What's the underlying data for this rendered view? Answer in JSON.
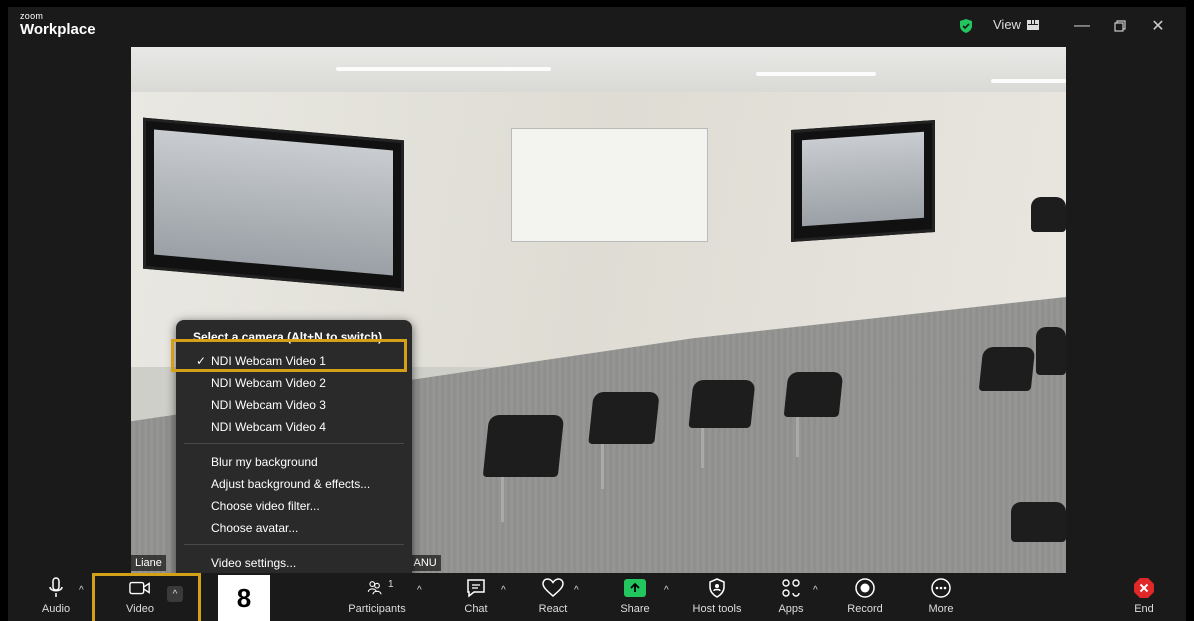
{
  "app": {
    "brand_small": "zoom",
    "brand_big": "Workplace",
    "view_label": "View"
  },
  "video": {
    "participant_name_left": "Liane",
    "participant_name_right": ", ANU"
  },
  "camera_menu": {
    "title": "Select a camera (Alt+N to switch)",
    "cameras": [
      "NDI Webcam Video 1",
      "NDI Webcam Video 2",
      "NDI Webcam Video 3",
      "NDI Webcam Video 4"
    ],
    "selected_camera": "NDI Webcam Video 1",
    "options": [
      "Blur my background",
      "Adjust background & effects...",
      "Choose video filter...",
      "Choose avatar..."
    ],
    "settings": "Video settings..."
  },
  "step_number": "8",
  "toolbar": {
    "audio": "Audio",
    "video": "Video",
    "participants": "Participants",
    "participants_count": "1",
    "chat": "Chat",
    "react": "React",
    "share": "Share",
    "host_tools": "Host tools",
    "apps": "Apps",
    "record": "Record",
    "more": "More",
    "end": "End"
  },
  "colors": {
    "highlight": "#d4a017",
    "share_green": "#22c55e",
    "end_red": "#e02828"
  }
}
